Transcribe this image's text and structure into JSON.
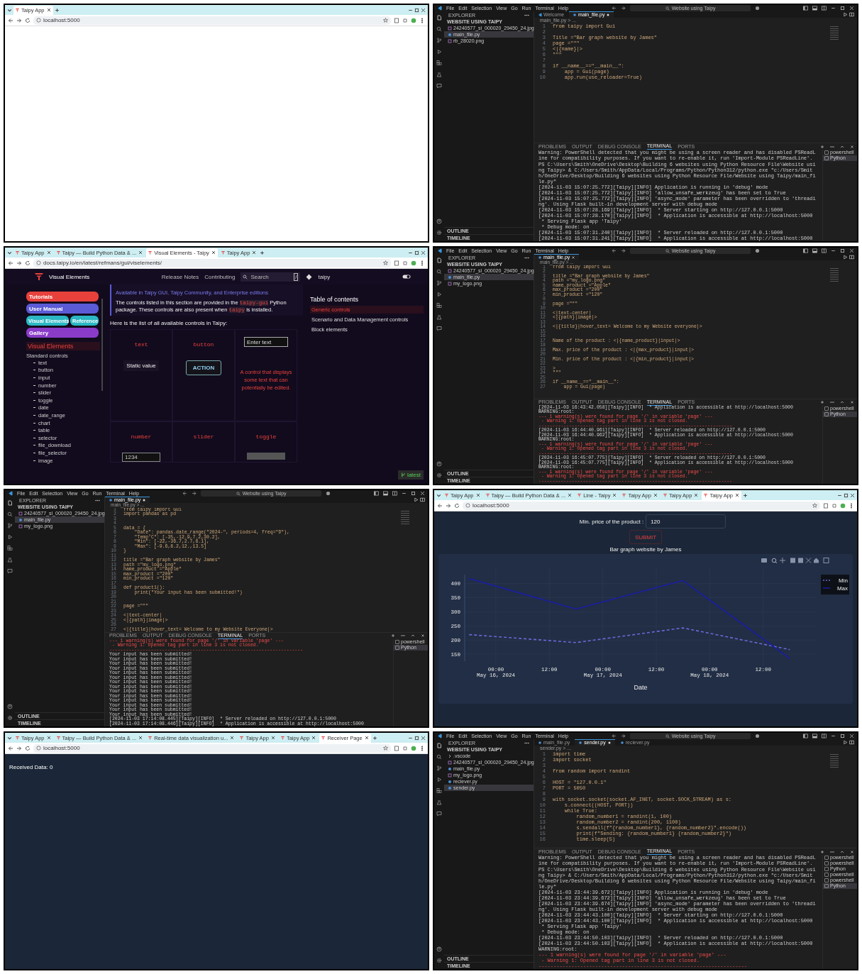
{
  "panels": [
    {
      "kind": "browser",
      "tabs": [
        {
          "label": "Taipy App",
          "selected": true
        }
      ],
      "url": "localhost:5000",
      "content": {
        "kind": "blank"
      }
    },
    {
      "kind": "vscode",
      "menu": [
        "File",
        "Edit",
        "Selection",
        "View",
        "Go",
        "Run",
        "Terminal",
        "Help"
      ],
      "title": "Website using Taipy",
      "explorer": "EXPLORER",
      "folder": "WEBSITE USING TAIPY",
      "files": [
        {
          "name": "24240577_sl_000020_29450_24.jpg",
          "kind": "image",
          "selected": false
        },
        {
          "name": "main_file.py",
          "kind": "python",
          "selected": true
        },
        {
          "name": "rb_28020.png",
          "kind": "image",
          "selected": false
        }
      ],
      "tabs": [
        {
          "label": "Welcome",
          "kind": "welcome",
          "selected": false,
          "modified": false
        },
        {
          "label": "main_file.py",
          "kind": "python",
          "selected": true,
          "modified": true
        }
      ],
      "breadcrumb": "main_file.py > ...",
      "code": [
        {
          "n": "1",
          "text": "from taipy import Gui"
        },
        {
          "n": "2"
        },
        {
          "n": "3",
          "text": "Title =\"Bar graph website by James\""
        },
        {
          "n": "4",
          "text": "page =\"\"\""
        },
        {
          "n": "5",
          "text": "<|{name}|>"
        },
        {
          "n": "6",
          "text": "\"\"\""
        },
        {
          "n": "7"
        },
        {
          "n": "8",
          "text": "if __name__==\"__main__\":"
        },
        {
          "n": "9",
          "text": "    app = Gui(page)"
        },
        {
          "n": "10",
          "text": "    app.run(use_reloader=True)"
        }
      ],
      "term_tabs": [
        {
          "label": "PROBLEMS",
          "selected": false
        },
        {
          "label": "OUTPUT",
          "selected": false
        },
        {
          "label": "DEBUG CONSOLE",
          "selected": false
        },
        {
          "label": "TERMINAL",
          "selected": true
        },
        {
          "label": "PORTS",
          "selected": false
        }
      ],
      "terminal": [
        {
          "text": "Warning: PowerShell detected that you might be using a screen reader and has disabled PSReadLine for compatibility purposes. If you want to re-enable it, run 'Import-Module PSReadLine'.",
          "kind": "gap"
        },
        {
          "text": "PS C:\\Users\\Smith\\OneDrive\\Desktop\\Building 6 websites using Python Resource File\\Website using Taipy> & C:/Users/Smith/AppData/Local/Programs/Python/Python312/python.exe \"c:/Users/Smith/OneDrive/Desktop/Building 6 websites using Python Resource File/Website using Taipy/main_file.py\"",
          "kind": "normal"
        },
        {
          "text": "[2024-11-03 15:07:25.772][Taipy][INFO] Application is running in 'debug' mode",
          "kind": "normal"
        },
        {
          "text": "[2024-11-03 15:07:25.772][Taipy][INFO] 'allow_unsafe_werkzeug' has been set to True",
          "kind": "normal"
        },
        {
          "text": "[2024-11-03 15:07:25.772][Taipy][INFO] 'async_mode' parameter has been overridden to 'threading'. Using Flask built-in development server with debug mode",
          "kind": "normal"
        },
        {
          "text": "[2024-11-03 15:07:28.169][Taipy][INFO]  * Server starting on http://127.0.0.1:5000",
          "kind": "normal"
        },
        {
          "text": "[2024-11-03 15:07:28.170][Taipy][INFO]  * Application is accessible at http://localhost:5000",
          "kind": "normal"
        },
        {
          "text": " * Serving Flask app 'Taipy'",
          "kind": "normal"
        },
        {
          "text": " * Debug mode: on",
          "kind": "normal"
        },
        {
          "text": "[2024-11-03 15:07:31.240][Taipy][INFO]  * Server reloaded on http://127.0.0.1:5000",
          "kind": "normal"
        },
        {
          "text": "[2024-11-03 15:07:31.241][Taipy][INFO]  * Application is accessible at http://localhost:5000",
          "kind": "normal"
        }
      ],
      "shells": [
        {
          "label": "powershell",
          "selected": false
        },
        {
          "label": "Python",
          "selected": true
        }
      ],
      "outline": "OUTLINE",
      "timeline": "TIMELINE"
    },
    {
      "kind": "browser",
      "tabs": [
        {
          "label": "Taipy App",
          "selected": false
        },
        {
          "label": "Taipy — Build Python Data & ...",
          "selected": false
        },
        {
          "label": "Visual Elements - Taipy",
          "selected": true
        },
        {
          "label": "Taipy App",
          "selected": false
        }
      ],
      "url": "docs.taipy.io/en/latest/refmans/gui/viselements/",
      "content": {
        "kind": "docs",
        "title": "Visual Elements",
        "nav": [
          "Release Notes",
          "Contributing"
        ],
        "search": "Search",
        "search_key": "/",
        "repo": "taipy",
        "buttons": [
          {
            "label": "Tutorials",
            "color": "#e8413c"
          },
          {
            "label": "User Manual",
            "color": "#5b5bd6"
          },
          {
            "label": "Visual Elements",
            "color": "#2bb8c4"
          },
          {
            "label": "Reference",
            "color": "#2bb8c4"
          },
          {
            "label": "Gallery",
            "color": "#8a3cc9"
          }
        ],
        "section": "Visual Elements",
        "subsection": "Standard controls",
        "items": [
          "text",
          "button",
          "input",
          "number",
          "slider",
          "toggle",
          "date",
          "date_range",
          "chart",
          "table",
          "selector",
          "file_download",
          "file_selector",
          "image"
        ],
        "note": "Available in Taipy GUI, Taipy Community, and Enterprise editions",
        "intro": [
          {
            "text": "The controls listed in this section are provided in the ",
            "kind": "plain"
          },
          {
            "text": "taipy-gui",
            "kind": "code"
          },
          {
            "text": " Python package. These controls are also present when ",
            "kind": "plain"
          },
          {
            "text": "taipy",
            "kind": "code"
          },
          {
            "text": " is installed.",
            "kind": "plain"
          }
        ],
        "lead": "Here is the list of all available controls in Taipy:",
        "controls": [
          {
            "kind": "text",
            "name": "text",
            "sample": "Static value"
          },
          {
            "kind": "button",
            "name": "button",
            "sample": "ACTION"
          },
          {
            "kind": "input",
            "placeholder": "Enter text",
            "description": "A control that displays some text that can potentially be edited."
          },
          {
            "kind": "number",
            "name": "number",
            "sample": "1234"
          },
          {
            "kind": "slider",
            "name": "slider"
          },
          {
            "kind": "toggle",
            "name": "toggle"
          }
        ],
        "toc": {
          "title": "Table of contents",
          "items": [
            {
              "label": "Generic controls",
              "selected": true
            },
            {
              "label": "Scenario and Data Management controls",
              "selected": false
            },
            {
              "label": "Block elements",
              "selected": false
            }
          ]
        },
        "version": "latest"
      }
    },
    {
      "kind": "vscode",
      "menu": [
        "File",
        "Edit",
        "Selection",
        "View",
        "Go",
        "Run",
        "Terminal",
        "Help"
      ],
      "title": "Website using Taipy",
      "explorer": "EXPLORER",
      "folder": "WEBSITE USING TAIPY",
      "files": [
        {
          "name": "24240577_sl_000020_29450_24.jpg",
          "kind": "image",
          "selected": false
        },
        {
          "name": "main_file.py",
          "kind": "python",
          "selected": true
        },
        {
          "name": "my_logo.png",
          "kind": "image",
          "selected": false
        }
      ],
      "tabs": [
        {
          "label": "main_file.py",
          "kind": "python",
          "selected": true,
          "modified": false
        }
      ],
      "breadcrumb": "main_file.py > ...",
      "code": [
        {
          "n": "1",
          "text": "from taipy import Gui"
        },
        {
          "n": "2"
        },
        {
          "n": "3",
          "text": "title =\"Bar graph website by James\""
        },
        {
          "n": "4",
          "text": "path =\"my_logo.png\""
        },
        {
          "n": "5",
          "text": "name_product =\"Apple\""
        },
        {
          "n": "6",
          "text": "max_product =\"200\""
        },
        {
          "n": "7",
          "text": "min_product =\"120\""
        },
        {
          "n": "8"
        },
        {
          "n": "9",
          "text": "page =\"\"\""
        },
        {
          "n": "10"
        },
        {
          "n": "11",
          "text": "<|text-center|"
        },
        {
          "n": "12",
          "text": "<|{path}|image|>"
        },
        {
          "n": "13"
        },
        {
          "n": "14",
          "text": "<|{title}|hover_text= Welcome to my Website everyone|>"
        },
        {
          "n": "15"
        },
        {
          "n": "16"
        },
        {
          "n": "17",
          "text": "Name of the product : <|{name_product}|input|>"
        },
        {
          "n": "18"
        },
        {
          "n": "19",
          "text": "Max. price of the product : <|{max_product}|input|>"
        },
        {
          "n": "20"
        },
        {
          "n": "21",
          "text": "Min. price of the product : <|{min_product}|input|>"
        },
        {
          "n": "22"
        },
        {
          "n": "23",
          "text": ">"
        },
        {
          "n": "24",
          "text": "\"\"\""
        },
        {
          "n": "25"
        },
        {
          "n": "26",
          "text": "if __name__==\"__main__\":"
        },
        {
          "n": "27",
          "text": "    app = Gui(page)"
        }
      ],
      "term_tabs": [
        {
          "label": "PROBLEMS",
          "selected": false
        },
        {
          "label": "OUTPUT",
          "selected": false
        },
        {
          "label": "DEBUG CONSOLE",
          "selected": false
        },
        {
          "label": "TERMINAL",
          "selected": true
        },
        {
          "label": "PORTS",
          "selected": false
        }
      ],
      "terminal": [
        {
          "text": "[2024-11-03 16:43:42.058][Taipy][INFO]  * Application is accessible at http://localhost:5000",
          "kind": "normal"
        },
        {
          "text": "WARNING:root:",
          "kind": "normal"
        },
        {
          "text": "--- 1 warning(s) were found for page '/' in variable 'page' ---",
          "kind": "error"
        },
        {
          "text": " - Warning 1: Opened tag part in line 3 is not closed.",
          "kind": "error"
        },
        {
          "text": "----------------------------------------------------------------------",
          "kind": "errorgap"
        },
        {
          "text": "[2024-11-03 16:44:40.961][Taipy][INFO]  * Server reloaded on http://127.0.0.1:5000",
          "kind": "normal"
        },
        {
          "text": "[2024-11-03 16:44:40.962][Taipy][INFO]  * Application is accessible at http://localhost:5000",
          "kind": "normal"
        },
        {
          "text": "WARNING:root:",
          "kind": "normal"
        },
        {
          "text": "--- 1 warning(s) were found for page '/' in variable 'page' ---",
          "kind": "error"
        },
        {
          "text": " - Warning 1: Opened tag part in line 3 is not closed.",
          "kind": "error"
        },
        {
          "text": "----------------------------------------------------------------------",
          "kind": "errorgap"
        },
        {
          "text": "[2024-11-03 16:45:07.775][Taipy][INFO]  * Server reloaded on http://127.0.0.1:5000",
          "kind": "normal"
        },
        {
          "text": "[2024-11-03 16:45:07.775][Taipy][INFO]  * Application is accessible at http://localhost:5000",
          "kind": "normal"
        },
        {
          "text": "WARNING:root:",
          "kind": "normal"
        },
        {
          "text": "--- 1 warning(s) were found for page '/' in variable 'page' ---",
          "kind": "error"
        },
        {
          "text": " - Warning 1: Opened tag part in line 3 is not closed.",
          "kind": "error"
        },
        {
          "text": "----------------------------------------------------------------------",
          "kind": "error"
        }
      ],
      "shells": [
        {
          "label": "powershell",
          "selected": false
        },
        {
          "label": "Python",
          "selected": true
        }
      ],
      "outline": "OUTLINE",
      "timeline": "TIMELINE"
    },
    {
      "kind": "vscode",
      "menu": [
        "File",
        "Edit",
        "Selection",
        "View",
        "Go",
        "Run",
        "Terminal",
        "Help"
      ],
      "title": "Website using Taipy",
      "explorer": "EXPLORER",
      "folder": "WEBSITE USING TAIPY",
      "files": [
        {
          "name": "24240577_sl_000020_29450_24.jpg",
          "kind": "image",
          "selected": false
        },
        {
          "name": "main_file.py",
          "kind": "python",
          "selected": true
        },
        {
          "name": "my_logo.png",
          "kind": "image",
          "selected": false
        }
      ],
      "tabs": [
        {
          "label": "main_file.py",
          "kind": "python",
          "selected": true,
          "modified": true
        }
      ],
      "breadcrumb": "main_file.py > ...",
      "code": [
        {
          "n": "1",
          "text": "from taipy import Gui"
        },
        {
          "n": "2",
          "text": "import pandas as pd"
        },
        {
          "n": "3"
        },
        {
          "n": "4"
        },
        {
          "n": "5",
          "text": "data = {"
        },
        {
          "n": "6",
          "text": "    \"Date\": pandas.date_range(\"2024-\", periods=4, freq=\"D\"),"
        },
        {
          "n": "7",
          "text": "    \"Temp°C\": [-35,-12.9,7.2,30.2],"
        },
        {
          "n": "8",
          "text": "    \"Min\": [-22,-36.7,2.7,6.1],"
        },
        {
          "n": "9",
          "text": "    \"Max\": [-9.6,8.2,12.,13.5]"
        },
        {
          "n": "10",
          "text": "}"
        },
        {
          "n": "11"
        },
        {
          "n": "12",
          "text": "title =\"Bar graph website by James\""
        },
        {
          "n": "13",
          "text": "path =\"my_logo.png\""
        },
        {
          "n": "14",
          "text": "name_product =\"Apple\""
        },
        {
          "n": "15",
          "text": "max_product =\"200\""
        },
        {
          "n": "16",
          "text": "min_product =\"120\""
        },
        {
          "n": "17"
        },
        {
          "n": "18",
          "text": "def product1():"
        },
        {
          "n": "19",
          "text": "    print(\"Your input has been submitted!\")"
        },
        {
          "n": "20"
        },
        {
          "n": "21"
        },
        {
          "n": "22",
          "text": "page =\"\"\""
        },
        {
          "n": "23"
        },
        {
          "n": "24",
          "text": "<|text-center|"
        },
        {
          "n": "25",
          "text": "<|{path}|image|>"
        },
        {
          "n": "26"
        },
        {
          "n": "27",
          "text": "<|{title}|hover_text= Welcome to my Website Everyone|>"
        }
      ],
      "term_tabs": [
        {
          "label": "PROBLEMS",
          "selected": false
        },
        {
          "label": "OUTPUT",
          "selected": false
        },
        {
          "label": "DEBUG CONSOLE",
          "selected": false
        },
        {
          "label": "TERMINAL",
          "selected": true
        },
        {
          "label": "PORTS",
          "selected": false
        }
      ],
      "terminal": [
        {
          "text": "--- 1 warning(s) were found for page '/' in variable 'page' ---",
          "kind": "error"
        },
        {
          "text": " - Warning 1: Opened tag part in line 3 is not closed.",
          "kind": "error"
        },
        {
          "text": "----------------------------------------------------------------------",
          "kind": "errorgap"
        },
        {
          "text": "Your input has been submitted!",
          "kind": "normal"
        },
        {
          "text": "Your input has been submitted!",
          "kind": "normal"
        },
        {
          "text": "Your input has been submitted!",
          "kind": "normal"
        },
        {
          "text": "Your input has been submitted!",
          "kind": "normal"
        },
        {
          "text": "Your input has been submitted!",
          "kind": "normal"
        },
        {
          "text": "Your input has been submitted!",
          "kind": "normal"
        },
        {
          "text": "Your input has been submitted!",
          "kind": "normal"
        },
        {
          "text": "Your input has been submitted!",
          "kind": "normal"
        },
        {
          "text": "Your input has been submitted!",
          "kind": "normal"
        },
        {
          "text": "Your input has been submitted!",
          "kind": "normal"
        },
        {
          "text": "Your input has been submitted!",
          "kind": "normal"
        },
        {
          "text": "Your input has been submitted!",
          "kind": "normal"
        },
        {
          "text": "Your input has been submitted!",
          "kind": "normal"
        },
        {
          "text": "Your input has been submitted!",
          "kind": "normal"
        },
        {
          "text": "[2024-11-03 17:14:08.445][Taipy][INFO]  * Server reloaded on http://127.0.0.1:5000",
          "kind": "normal"
        },
        {
          "text": "[2024-11-03 17:14:08.446][Taipy][INFO]  * Application is accessible at http://localhost:5000",
          "kind": "normal"
        }
      ],
      "shells": [
        {
          "label": "powershell",
          "selected": false
        },
        {
          "label": "Python",
          "selected": true
        }
      ],
      "outline": "OUTLINE",
      "timeline": "TIMELINE"
    },
    {
      "kind": "browser",
      "tabs": [
        {
          "label": "Taipy App",
          "selected": false
        },
        {
          "label": "Taipy — Build Python Data & ...",
          "selected": false
        },
        {
          "label": "Line - Taipy",
          "selected": false
        },
        {
          "label": "Taipy App",
          "selected": false
        },
        {
          "label": "Taipy App",
          "selected": false
        },
        {
          "label": "Taipy App",
          "selected": true
        }
      ],
      "url": "localhost:5000",
      "content": {
        "kind": "chart",
        "field_label": "Min. price of the product :",
        "field_value": "120",
        "submit": "SUBMIT",
        "title": "Bar graph website by James",
        "chart_data": {
          "type": "line",
          "xlabel": "Date",
          "x": [
            "2024-05-15T18:00",
            "2024-05-16T18:00",
            "2024-05-17T18:00",
            "2024-05-18T18:00"
          ],
          "series": [
            {
              "name": "Min",
              "color": "#6a6ad8",
              "line_style": "dashed",
              "values": [
                219,
                191,
                243,
                166
              ]
            },
            {
              "name": "Max",
              "color": "#1c1ca8",
              "line_style": "solid",
              "values": [
                418,
                310,
                411,
                134
              ]
            }
          ],
          "grid": true,
          "legend": "top-right",
          "ylim": [
            125,
            432
          ],
          "xlim": [
            "2024-05-15T17:00",
            "2024-05-19T00:00"
          ],
          "xticks": [
            {
              "value": "2024-05-16T00:00",
              "label": "00:00 May 16, 2024"
            },
            {
              "value": "2024-05-16T12:00",
              "label": "12:00"
            },
            {
              "value": "2024-05-17T00:00",
              "label": "00:00 May 17, 2024"
            },
            {
              "value": "2024-05-17T12:00",
              "label": "12:00"
            },
            {
              "value": "2024-05-18T00:00",
              "label": "00:00 May 18, 2024"
            },
            {
              "value": "2024-05-18T12:00",
              "label": "12:00"
            }
          ],
          "yticks": [
            150,
            200,
            250,
            300,
            350,
            400
          ]
        }
      }
    },
    {
      "kind": "browser",
      "tabs": [
        {
          "label": "Taipy App",
          "selected": false
        },
        {
          "label": "Taipy — Build Python Data & ...",
          "selected": false
        },
        {
          "label": "Real-time data visualization u...",
          "selected": false
        },
        {
          "label": "Taipy App",
          "selected": false
        },
        {
          "label": "Taipy App",
          "selected": false
        },
        {
          "label": "Receiver Page",
          "selected": true
        }
      ],
      "url": "localhost:5000",
      "content": {
        "kind": "received",
        "text": "Received Data: 0"
      }
    },
    {
      "kind": "vscode",
      "menu": [
        "File",
        "Edit",
        "Selection",
        "View",
        "Go",
        "Run",
        "Terminal",
        "Help"
      ],
      "title": "Website using Taipy",
      "explorer": "EXPLORER",
      "folder": "WEBSITE USING TAIPY",
      "files": [
        {
          "name": ".vscode",
          "kind": "folder",
          "selected": false
        },
        {
          "name": "24240577_sl_000020_29450_24.jpg",
          "kind": "image",
          "selected": false
        },
        {
          "name": "main_file.py",
          "kind": "python",
          "selected": false
        },
        {
          "name": "my_logo.png",
          "kind": "image",
          "selected": false
        },
        {
          "name": "reciever.py",
          "kind": "python",
          "selected": false
        },
        {
          "name": "sender.py",
          "kind": "python",
          "selected": true
        }
      ],
      "tabs": [
        {
          "label": "main_file.py",
          "kind": "python",
          "selected": false,
          "modified": false
        },
        {
          "label": "sender.py",
          "kind": "python",
          "selected": true,
          "modified": true
        },
        {
          "label": "reciever.py",
          "kind": "python",
          "selected": false,
          "modified": false
        }
      ],
      "breadcrumb": "sender.py > ...",
      "code": [
        {
          "n": "1",
          "text": "import time"
        },
        {
          "n": "2",
          "text": "import socket"
        },
        {
          "n": "3"
        },
        {
          "n": "4",
          "text": "from random import randint"
        },
        {
          "n": "5"
        },
        {
          "n": "6",
          "text": "HOST = \"127.0.0.1\""
        },
        {
          "n": "7",
          "text": "PORT = 5050"
        },
        {
          "n": "8"
        },
        {
          "n": "9",
          "text": "with socket.socket(socket.AF_INET, socket.SOCK_STREAM) as s:"
        },
        {
          "n": "10",
          "text": "    s.connect((HOST, PORT))"
        },
        {
          "n": "11",
          "text": "    while True:"
        },
        {
          "n": "12",
          "text": "        random_number1 = randint(1, 100)"
        },
        {
          "n": "13",
          "text": "        random_number2 = randint(200, 1100)"
        },
        {
          "n": "14",
          "text": "        s.sendall(f\"{random_number1}, {random_number2}\".encode())"
        },
        {
          "n": "15",
          "text": "        print(f\"Sending: {random_number1} {random_number2}\")"
        },
        {
          "n": "16",
          "text": "        time.sleep(5)"
        }
      ],
      "term_tabs": [
        {
          "label": "PROBLEMS",
          "selected": false
        },
        {
          "label": "OUTPUT",
          "selected": false
        },
        {
          "label": "DEBUG CONSOLE",
          "selected": false
        },
        {
          "label": "TERMINAL",
          "selected": true
        },
        {
          "label": "PORTS",
          "selected": false
        }
      ],
      "terminal": [
        {
          "text": "Warning: PowerShell detected that you might be using a screen reader and has disabled PSReadLine for compatibility purposes. If you want to re-enable it, run 'Import-Module PSReadLine'.",
          "kind": "gap"
        },
        {
          "text": "PS C:\\Users\\Smith\\OneDrive\\Desktop\\Building 6 websites using Python Resource File\\Website using Taipy> & C:/Users/Smith/AppData/Local/Programs/Python/Python312/python.exe \"c:/Users/Smith/OneDrive/Desktop/Building 6 websites using Python Resource File/Website using Taipy/main_file.py\"",
          "kind": "normal"
        },
        {
          "text": "[2024-11-03 23:44:39.672][Taipy][INFO] Application is running in 'debug' mode",
          "kind": "normal"
        },
        {
          "text": "[2024-11-03 23:44:39.672][Taipy][INFO] 'allow_unsafe_werkzeug' has been set to True",
          "kind": "normal"
        },
        {
          "text": "[2024-11-03 23:44:39.674][Taipy][INFO] 'async_mode' parameter has been overridden to 'threading'. Using Flask built-in development server with debug mode",
          "kind": "normal"
        },
        {
          "text": "[2024-11-03 23:44:43.100][Taipy][INFO]  * Server starting on http://127.0.0.1:5000",
          "kind": "normal"
        },
        {
          "text": "[2024-11-03 23:44:43.100][Taipy][INFO]  * Application is accessible at http://localhost:5000",
          "kind": "normal"
        },
        {
          "text": " * Serving Flask app 'Taipy'",
          "kind": "normal"
        },
        {
          "text": " * Debug mode: on",
          "kind": "normal"
        },
        {
          "text": "[2024-11-03 23:44:50.103][Taipy][INFO]  * Server reloaded on http://127.0.0.1:5000",
          "kind": "normal"
        },
        {
          "text": "[2024-11-03 23:44:50.103][Taipy][INFO]  * Application is accessible at http://localhost:5000",
          "kind": "normal"
        },
        {
          "text": "WARNING:root:",
          "kind": "normal"
        },
        {
          "text": "--- 1 warning(s) were found for page '/' in variable 'page' ---",
          "kind": "error"
        },
        {
          "text": " - Warning 1: Opened tag part in line 3 is not closed.",
          "kind": "error"
        },
        {
          "text": "----------------------------------------------------------------------",
          "kind": "error"
        }
      ],
      "shells": [
        {
          "label": "powershell",
          "selected": false
        },
        {
          "label": "powershell",
          "selected": false
        },
        {
          "label": "Python",
          "selected": false
        },
        {
          "label": "powershell",
          "selected": false
        },
        {
          "label": "powershell",
          "selected": false
        },
        {
          "label": "Python",
          "selected": true
        }
      ],
      "outline": "OUTLINE",
      "timeline": "TIMELINE"
    }
  ]
}
